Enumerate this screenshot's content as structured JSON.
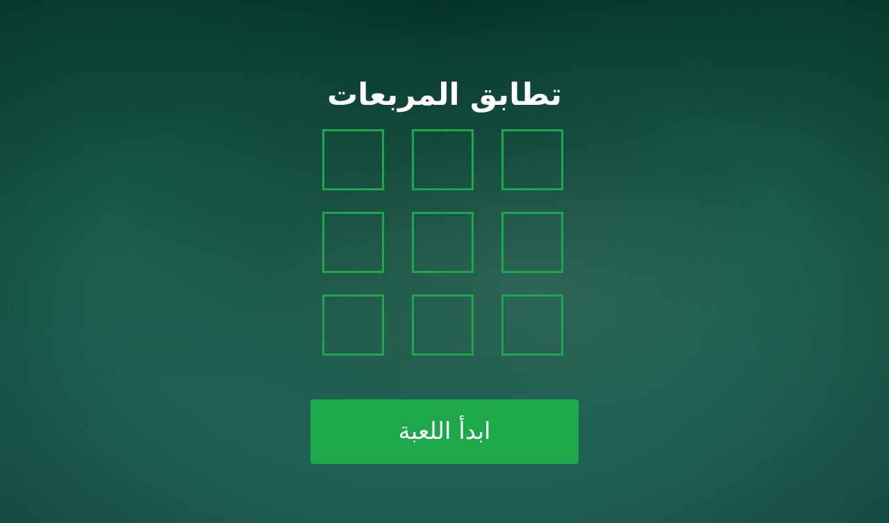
{
  "game": {
    "title": "تطابق المربعات",
    "start_button_label": "ابدأ اللعبة",
    "board": {
      "rows": 3,
      "columns": 3,
      "tiles": [
        {
          "id": 1,
          "state": "empty"
        },
        {
          "id": 2,
          "state": "empty"
        },
        {
          "id": 3,
          "state": "empty"
        },
        {
          "id": 4,
          "state": "empty"
        },
        {
          "id": 5,
          "state": "empty"
        },
        {
          "id": 6,
          "state": "empty"
        },
        {
          "id": 7,
          "state": "empty"
        },
        {
          "id": 8,
          "state": "empty"
        },
        {
          "id": 9,
          "state": "empty"
        }
      ]
    }
  },
  "colors": {
    "background": "#1a5c4c",
    "accent": "#1da84c",
    "tile_border": "#1fa84b",
    "text": "#ffffff"
  }
}
